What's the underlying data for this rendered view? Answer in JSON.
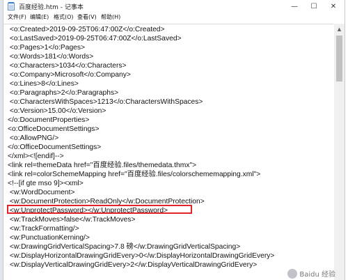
{
  "window": {
    "title": "百度经验.htm - 记事本",
    "controls": {
      "minimize": "—",
      "maximize": "☐",
      "close": "✕"
    }
  },
  "menu": [
    "文件(F)",
    "编辑(E)",
    "格式(O)",
    "查看(V)",
    "帮助(H)"
  ],
  "lines": [
    " <o:Created>2019-09-25T06:47:00Z</o:Created>",
    " <o:LastSaved>2019-09-25T06:47:00Z</o:LastSaved>",
    " <o:Pages>1</o:Pages>",
    " <o:Words>181</o:Words>",
    " <o:Characters>1034</o:Characters>",
    " <o:Company>Microsoft</o:Company>",
    " <o:Lines>8</o:Lines>",
    " <o:Paragraphs>2</o:Paragraphs>",
    " <o:CharactersWithSpaces>1213</o:CharactersWithSpaces>",
    " <o:Version>15.00</o:Version>",
    "</o:DocumentProperties>",
    "<o:OfficeDocumentSettings>",
    " <o:AllowPNG/>",
    "</o:OfficeDocumentSettings>",
    "</xml><![endif]-->",
    "<link rel=themeData href=\"百度经验.files/themedata.thmx\">",
    "<link rel=colorSchemeMapping href=\"百度经验.files/colorschememapping.xml\">",
    "<!--[if gte mso 9]><xml>",
    " <w:WordDocument>",
    " <w:DocumentProtection>ReadOnly</w:DocumentProtection>",
    " <w:UnprotectPassword></w:UnprotectPassword>",
    " <w:TrackMoves>false</w:TrackMoves>",
    " <w:TrackFormatting/>",
    " <w:PunctuationKerning/>",
    " <w:DrawingGridVerticalSpacing>7.8 磅</w:DrawingGridVerticalSpacing>",
    " <w:DisplayHorizontalDrawingGridEvery>0</w:DisplayHorizontalDrawingGridEvery>",
    " <w:DisplayVerticalDrawingGridEvery>2</w:DisplayVerticalDrawingGridEvery>"
  ],
  "watermark": "Baidu 经验",
  "colors": {
    "highlight": "#e2232a",
    "text": "#111111"
  }
}
